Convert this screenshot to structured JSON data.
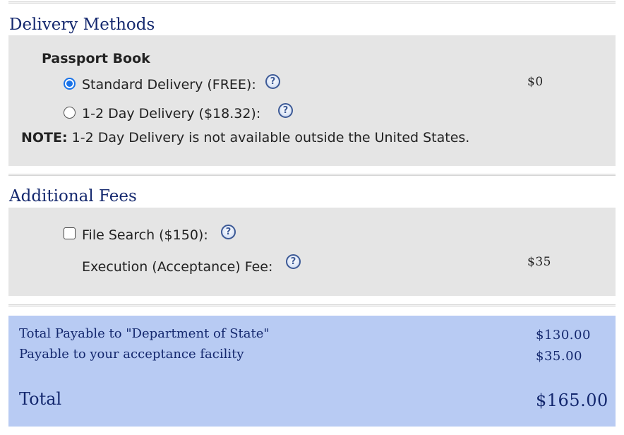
{
  "delivery": {
    "title": "Delivery Methods",
    "subheading": "Passport Book",
    "options": [
      {
        "label": "Standard Delivery (FREE):",
        "selected": true
      },
      {
        "label": "1-2 Day Delivery ($18.32):",
        "selected": false
      }
    ],
    "price": "$0",
    "note_label": "NOTE:",
    "note_text": " 1-2 Day Delivery is not available outside the United States."
  },
  "additional_fees": {
    "title": "Additional Fees",
    "file_search_label": "File Search ($150):",
    "file_search_checked": false,
    "execution_fee_label": "Execution (Acceptance) Fee:",
    "execution_fee_price": "$35"
  },
  "summary": {
    "total_state_label": "Total Payable to \"Department of State\"",
    "total_state_value": "$130.00",
    "facility_label": "Payable to your acceptance facility",
    "facility_value": "$35.00",
    "total_label": "Total",
    "total_value": "$165.00"
  },
  "icons": {
    "help": "question-help-icon",
    "help_glyph": "?"
  },
  "colors": {
    "heading": "#14286e",
    "panel": "#e5e5e5",
    "summary_bg": "#b8cbf3",
    "radio_accent": "#1a73e8"
  }
}
